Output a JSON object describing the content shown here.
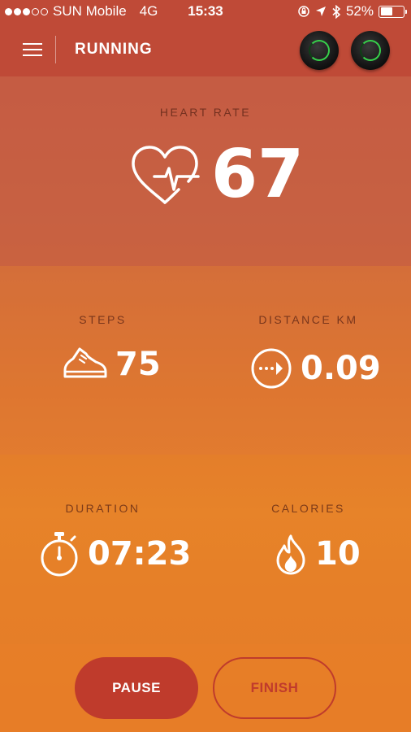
{
  "status_bar": {
    "carrier": "SUN Mobile",
    "network": "4G",
    "time": "15:33",
    "battery_percent": "52%",
    "battery_level": 0.52,
    "signal_bars_filled": 3,
    "signal_bars_total": 5
  },
  "header": {
    "title": "RUNNING"
  },
  "heart_rate": {
    "label": "HEART RATE",
    "value": "67"
  },
  "steps": {
    "label": "STEPS",
    "value": "75"
  },
  "distance": {
    "label": "DISTANCE KM",
    "value": "0.09"
  },
  "duration": {
    "label": "DURATION",
    "value": "07:23"
  },
  "calories": {
    "label": "CALORIES",
    "value": "10"
  },
  "actions": {
    "pause_label": "PAUSE",
    "finish_label": "FINISH"
  },
  "colors": {
    "accent": "#bf3b2c",
    "header_bg": "#bf4a37",
    "earbud_led": "#37d04b"
  },
  "icons": {
    "menu": "hamburger-icon",
    "heart": "heart-pulse-icon",
    "steps": "sneaker-icon",
    "distance": "arrow-circle-icon",
    "duration": "stopwatch-icon",
    "calories": "flame-icon"
  }
}
